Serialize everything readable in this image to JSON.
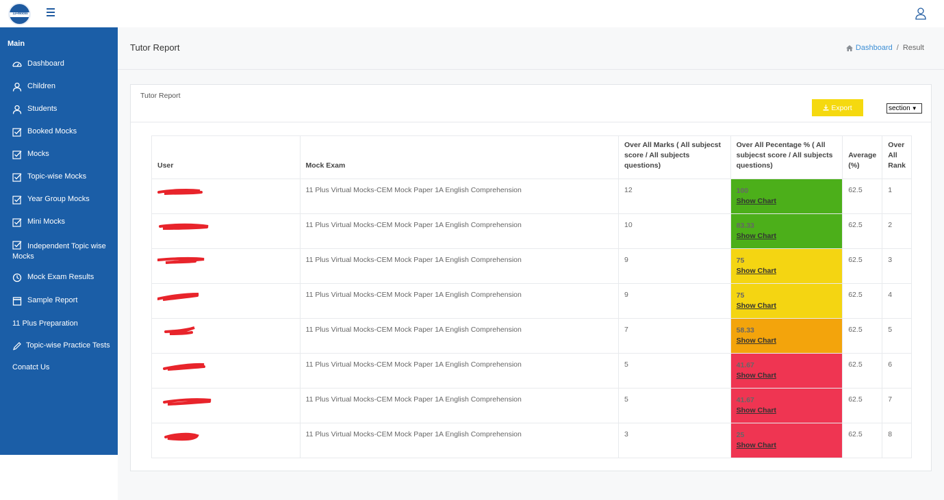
{
  "app": {
    "logo_text": "11+Mocks"
  },
  "sidebar": {
    "heading": "Main",
    "items": [
      {
        "label": "Dashboard",
        "icon": "dashboard-gauge-icon"
      },
      {
        "label": "Children",
        "icon": "user-icon"
      },
      {
        "label": "Students",
        "icon": "user-icon"
      },
      {
        "label": "Booked Mocks",
        "icon": "checkbox-icon"
      },
      {
        "label": "Mocks",
        "icon": "checkbox-icon"
      },
      {
        "label": "Topic-wise Mocks",
        "icon": "checkbox-icon"
      },
      {
        "label": "Year Group Mocks",
        "icon": "checkbox-icon"
      },
      {
        "label": "Mini Mocks",
        "icon": "checkbox-icon"
      },
      {
        "label": "Independent Topic wise Mocks",
        "icon": "checkbox-icon"
      },
      {
        "label": "Mock Exam Results",
        "icon": "clock-icon"
      },
      {
        "label": "Sample Report",
        "icon": "calendar-icon"
      },
      {
        "label": "11 Plus Preparation",
        "icon": ""
      },
      {
        "label": "Topic-wise Practice Tests",
        "icon": "pencil-icon"
      },
      {
        "label": "Conatct Us",
        "icon": ""
      }
    ]
  },
  "header": {
    "title": "Tutor Report",
    "breadcrumb": {
      "home": "Dashboard",
      "current": "Result"
    }
  },
  "card": {
    "title": "Tutor Report",
    "export_label": "Export",
    "section_select": "section"
  },
  "table": {
    "headers": [
      "User",
      "Mock Exam",
      "Over All Marks ( All subjecst score / All subjects questions)",
      "Over All Pecentage % ( All subjecst score / All subjects questions)",
      "Average (%)",
      "Over All Rank"
    ],
    "show_chart_label": "Show Chart",
    "rows": [
      {
        "exam": "11 Plus Virtual Mocks-CEM Mock Paper 1A English Comprehension",
        "marks": "12",
        "pct": "100",
        "pct_color": "#4caf1a",
        "avg": "62.5",
        "rank": "1"
      },
      {
        "exam": "11 Plus Virtual Mocks-CEM Mock Paper 1A English Comprehension",
        "marks": "10",
        "pct": "83.33",
        "pct_color": "#4caf1a",
        "avg": "62.5",
        "rank": "2"
      },
      {
        "exam": "11 Plus Virtual Mocks-CEM Mock Paper 1A English Comprehension",
        "marks": "9",
        "pct": "75",
        "pct_color": "#f4d512",
        "avg": "62.5",
        "rank": "3"
      },
      {
        "exam": "11 Plus Virtual Mocks-CEM Mock Paper 1A English Comprehension",
        "marks": "9",
        "pct": "75",
        "pct_color": "#f4d512",
        "avg": "62.5",
        "rank": "4"
      },
      {
        "exam": "11 Plus Virtual Mocks-CEM Mock Paper 1A English Comprehension",
        "marks": "7",
        "pct": "58.33",
        "pct_color": "#f3a40c",
        "avg": "62.5",
        "rank": "5"
      },
      {
        "exam": "11 Plus Virtual Mocks-CEM Mock Paper 1A English Comprehension",
        "marks": "5",
        "pct": "41.67",
        "pct_color": "#ef3552",
        "avg": "62.5",
        "rank": "6"
      },
      {
        "exam": "11 Plus Virtual Mocks-CEM Mock Paper 1A English Comprehension",
        "marks": "5",
        "pct": "41.67",
        "pct_color": "#ef3552",
        "avg": "62.5",
        "rank": "7"
      },
      {
        "exam": "11 Plus Virtual Mocks-CEM Mock Paper 1A English Comprehension",
        "marks": "3",
        "pct": "25",
        "pct_color": "#ef3552",
        "avg": "62.5",
        "rank": "8"
      }
    ]
  }
}
